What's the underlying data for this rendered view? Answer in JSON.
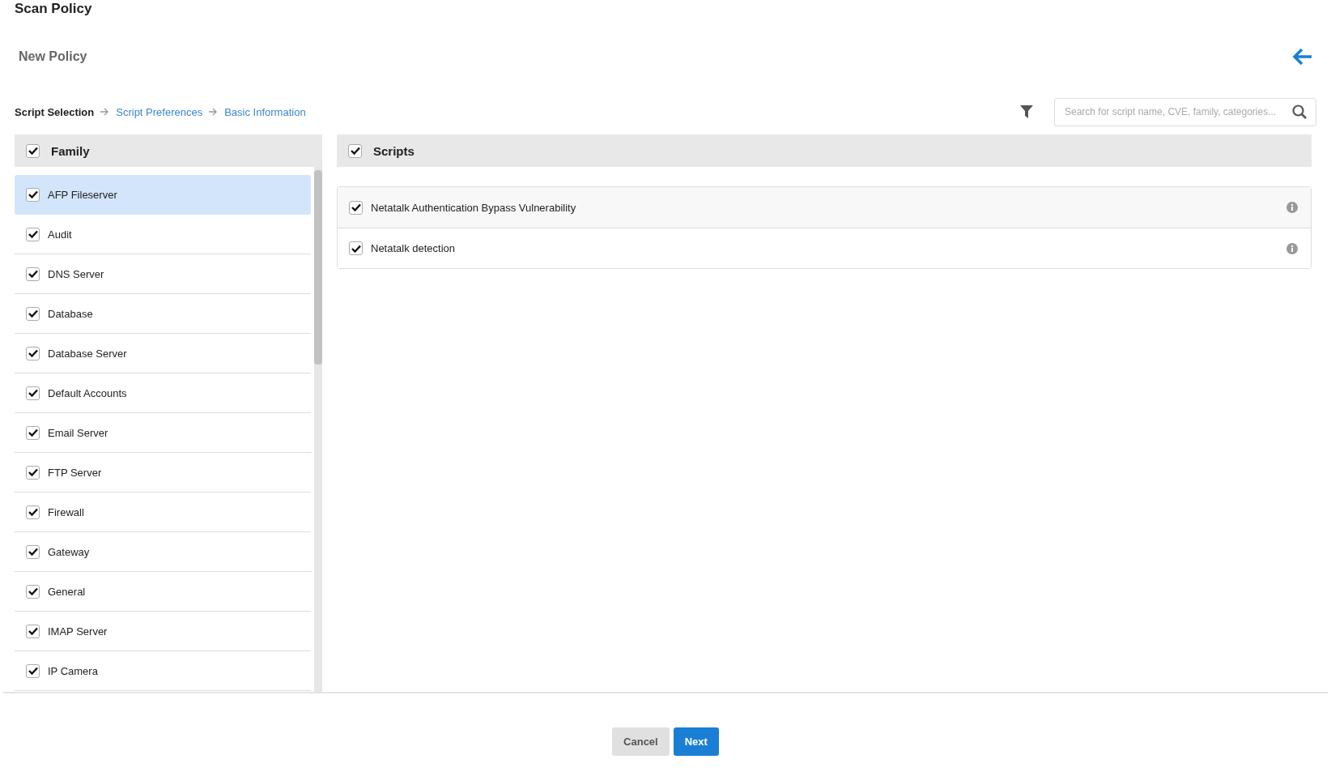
{
  "page": {
    "title": "Scan Policy",
    "subtitle": "New Policy"
  },
  "breadcrumb": [
    {
      "label": "Script Selection",
      "selected": true
    },
    {
      "label": "Script Preferences",
      "selected": false
    },
    {
      "label": "Basic Information",
      "selected": false
    }
  ],
  "search": {
    "placeholder": "Search for script name, CVE, family, categories..."
  },
  "family": {
    "header": "Family",
    "checked": true,
    "items": [
      {
        "label": "AFP Fileserver",
        "checked": true,
        "selected": true
      },
      {
        "label": "Audit",
        "checked": true,
        "selected": false
      },
      {
        "label": "DNS Server",
        "checked": true,
        "selected": false
      },
      {
        "label": "Database",
        "checked": true,
        "selected": false
      },
      {
        "label": "Database Server",
        "checked": true,
        "selected": false
      },
      {
        "label": "Default Accounts",
        "checked": true,
        "selected": false
      },
      {
        "label": "Email Server",
        "checked": true,
        "selected": false
      },
      {
        "label": "FTP Server",
        "checked": true,
        "selected": false
      },
      {
        "label": "Firewall",
        "checked": true,
        "selected": false
      },
      {
        "label": "Gateway",
        "checked": true,
        "selected": false
      },
      {
        "label": "General",
        "checked": true,
        "selected": false
      },
      {
        "label": "IMAP Server",
        "checked": true,
        "selected": false
      },
      {
        "label": "IP Camera",
        "checked": true,
        "selected": false
      }
    ]
  },
  "scripts": {
    "header": "Scripts",
    "checked": true,
    "items": [
      {
        "label": "Netatalk Authentication Bypass Vulnerability",
        "checked": true
      },
      {
        "label": "Netatalk detection",
        "checked": true
      }
    ]
  },
  "buttons": [
    {
      "label": "Cancel",
      "kind": "secondary"
    },
    {
      "label": "Next",
      "kind": "primary"
    }
  ]
}
